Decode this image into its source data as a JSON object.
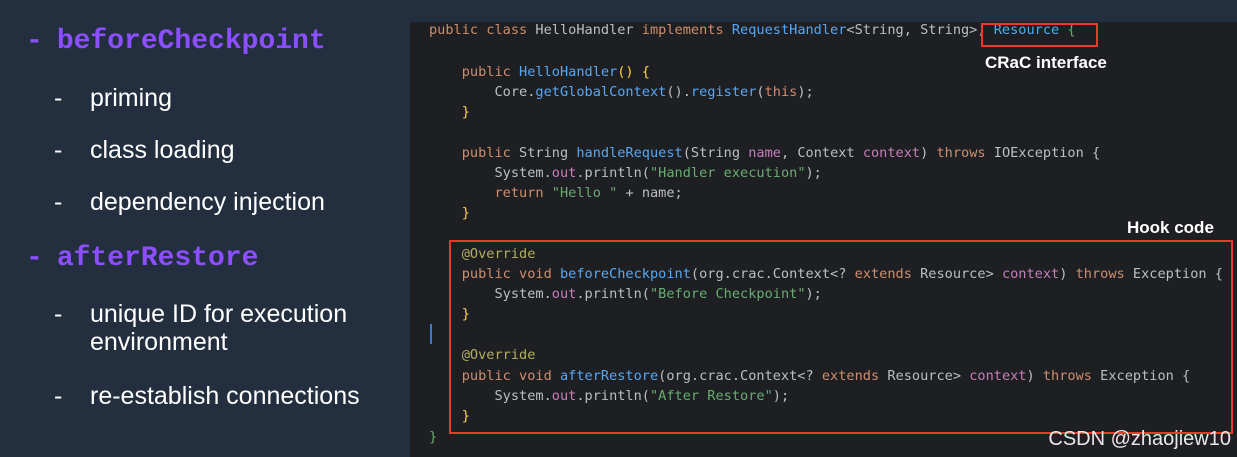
{
  "left": {
    "headings": [
      {
        "dash": "-",
        "label": "beforeCheckpoint"
      },
      {
        "dash": "-",
        "label": "afterRestore"
      }
    ],
    "before_items": [
      "priming",
      "class loading",
      "dependency injection"
    ],
    "after_items": [
      "unique ID for execution",
      "environment",
      "re-establish connections"
    ],
    "bullet_dash": "-"
  },
  "labels": {
    "crac": "CRaC interface",
    "hook": "Hook code"
  },
  "code": {
    "l1": {
      "a": "public class ",
      "b": "HelloHandler",
      "c": " implements ",
      "d": "RequestHandler",
      "e": "<String, String>, ",
      "f": "Resource",
      "g": " {"
    },
    "l3": {
      "a": "    public ",
      "b": "HelloHandler",
      "c": "() {"
    },
    "l4": {
      "a": "        Core.",
      "b": "getGlobalContext",
      "c": "().",
      "d": "register",
      "e": "(",
      "f": "this",
      "g": ");"
    },
    "l5": {
      "a": "    }"
    },
    "l7": {
      "a": "    public ",
      "b": "String ",
      "c": "handleRequest",
      "d": "(String ",
      "e": "name",
      "f": ", Context ",
      "g": "context",
      "h": ") ",
      "i": "throws",
      "j": " IOException {"
    },
    "l8": {
      "a": "        System.",
      "b": "out",
      "c": ".println(",
      "d": "\"Handler execution\"",
      "e": ");"
    },
    "l9": {
      "a": "        ",
      "b": "return ",
      "c": "\"Hello \"",
      "d": " + name;"
    },
    "l10": {
      "a": "    }"
    },
    "l12": {
      "a": "    @",
      "b": "Override"
    },
    "l13": {
      "a": "    public void ",
      "b": "beforeCheckpoint",
      "c": "(org.crac.Context<? ",
      "d": "extends ",
      "e": "Resource",
      "f": "> ",
      "g": "context",
      "h": ") ",
      "i": "throws",
      "j": " Exception {"
    },
    "l14": {
      "a": "        System.",
      "b": "out",
      "c": ".println(",
      "d": "\"Before Checkpoint\"",
      "e": ");"
    },
    "l15": {
      "a": "    }"
    },
    "l17": {
      "a": "    @",
      "b": "Override"
    },
    "l18": {
      "a": "    public void ",
      "b": "afterRestore",
      "c": "(org.crac.Context<? ",
      "d": "extends ",
      "e": "Resource",
      "f": "> ",
      "g": "context",
      "h": ") ",
      "i": "throws",
      "j": " Exception {"
    },
    "l19": {
      "a": "        System.",
      "b": "out",
      "c": ".println(",
      "d": "\"After Restore\"",
      "e": ");"
    },
    "l20": {
      "a": "    }"
    },
    "l21": {
      "a": "}"
    }
  },
  "watermark": "CSDN @zhaojiew10",
  "colors": {
    "accent_purple": "#8c4fff",
    "highlight_red": "#e8392c",
    "background": "#232f3e"
  }
}
